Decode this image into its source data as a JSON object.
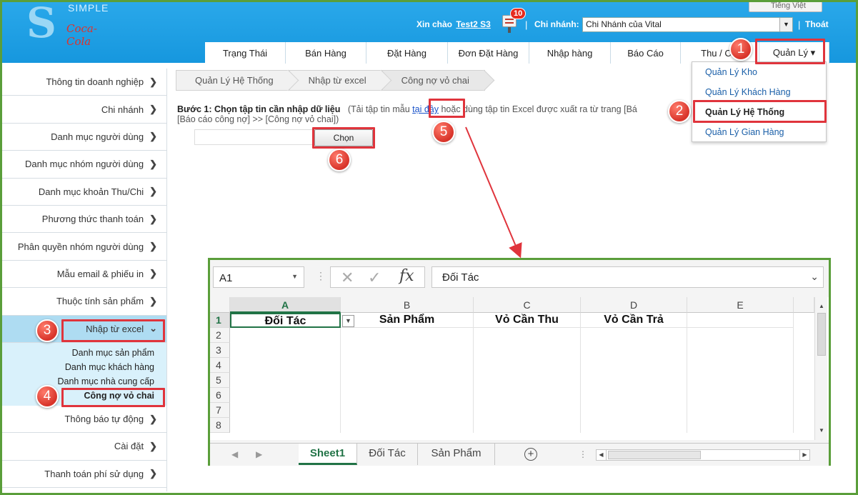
{
  "header": {
    "brand": "SIMPLE",
    "partner_logo": "Coca-Cola",
    "language": "Tiếng Việt",
    "greeting": "Xin chào",
    "user": "Test2 S3",
    "notification_count": "10",
    "separator": "|",
    "branch_label": "Chi nhánh:",
    "branch_value": "Chi Nhánh của Vital",
    "logout": "Thoát"
  },
  "nav": [
    {
      "label": "Trạng Thái"
    },
    {
      "label": "Bán Hàng"
    },
    {
      "label": "Đặt Hàng"
    },
    {
      "label": "Đơn Đặt Hàng"
    },
    {
      "label": "Nhập hàng"
    },
    {
      "label": "Báo Cáo"
    },
    {
      "label": "Thu / Chi"
    },
    {
      "label": "Quản Lý ▾"
    }
  ],
  "dropdown": [
    {
      "label": "Quản Lý Kho"
    },
    {
      "label": "Quản Lý Khách Hàng"
    },
    {
      "label": "Quản Lý Hệ Thống"
    },
    {
      "label": "Quản Lý Gian Hàng"
    }
  ],
  "sidebar": {
    "items_top": [
      {
        "label": "Thông tin doanh nghiệp"
      },
      {
        "label": "Chi nhánh"
      },
      {
        "label": "Danh mục người dùng"
      },
      {
        "label": "Danh mục nhóm người dùng"
      },
      {
        "label": "Danh mục khoản Thu/Chi"
      },
      {
        "label": "Phương thức thanh toán"
      },
      {
        "label": "Phân quyền nhóm người dùng"
      },
      {
        "label": "Mẫu email & phiếu in"
      },
      {
        "label": "Thuộc tính sản phẩm"
      }
    ],
    "active": {
      "label": "Nhập từ excel"
    },
    "sub_items": [
      {
        "label": "Danh mục sản phẩm"
      },
      {
        "label": "Danh mục khách hàng"
      },
      {
        "label": "Danh mục nhà cung cấp"
      },
      {
        "label": "Công nợ vỏ chai"
      }
    ],
    "items_bottom": [
      {
        "label": "Thông báo tự động"
      },
      {
        "label": "Cài đặt"
      },
      {
        "label": "Thanh toán phí sử dụng"
      }
    ]
  },
  "breadcrumb": [
    "Quản Lý Hệ Thống",
    "Nhập từ excel",
    "Công nợ vỏ chai"
  ],
  "step": {
    "title": "Bước 1: Chọn tập tin cần nhập dữ liệu",
    "hint_before": "(Tải tập tin mẫu",
    "link": "tại đây",
    "hint_after": "hoặc dùng tập tin Excel được xuất ra từ trang [Bá",
    "line2": "[Báo cáo công nợ] >> [Công nợ vỏ chai])",
    "button": "Chọn"
  },
  "callouts": [
    "1",
    "2",
    "3",
    "4",
    "5",
    "6"
  ],
  "excel": {
    "name_box": "A1",
    "formula_value": "Đối Tác",
    "fx": "fx",
    "columns": [
      "A",
      "B",
      "C",
      "D",
      "E"
    ],
    "rows": [
      "1",
      "2",
      "3",
      "4",
      "5",
      "6",
      "7",
      "8"
    ],
    "headers": [
      "Đối Tác",
      "Sản Phẩm",
      "Vỏ Cần Thu",
      "Vỏ Cần Trả"
    ],
    "tabs": [
      "Sheet1",
      "Đối Tác",
      "Sản Phẩm"
    ]
  },
  "colors": {
    "header_blue": "#1697de",
    "highlight_red": "#e0343c",
    "frame_green": "#5a9e3a",
    "excel_green": "#217346",
    "active_side": "#aedcf2"
  }
}
